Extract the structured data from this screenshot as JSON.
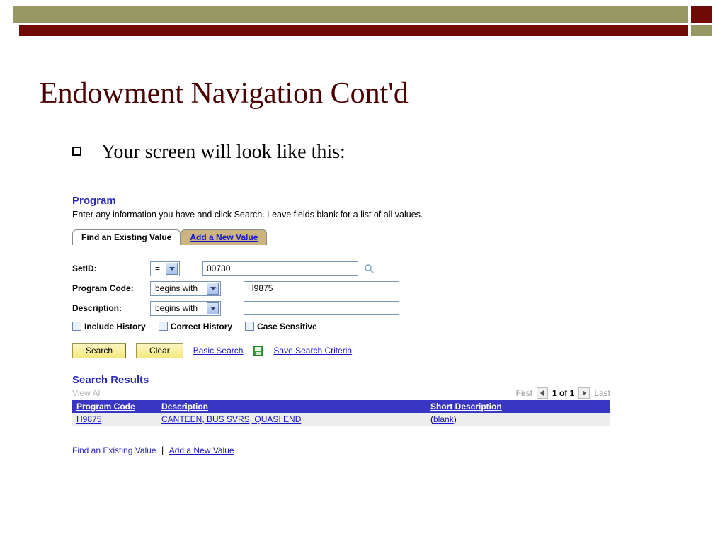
{
  "slide": {
    "title": "Endowment Navigation Cont'd",
    "bullet_text": "Your screen will look like this:"
  },
  "app": {
    "heading": "Program",
    "instruction": "Enter any information you have and click Search. Leave fields blank for a list of all values.",
    "tabs": {
      "active_label": "Find an Existing Value",
      "inactive_label": "Add a New Value"
    },
    "fields": {
      "setid": {
        "label": "SetID:",
        "op": "=",
        "value": "00730"
      },
      "program_code": {
        "label": "Program Code:",
        "op": "begins with",
        "value": "H9875"
      },
      "description": {
        "label": "Description:",
        "op": "begins with",
        "value": ""
      }
    },
    "checkboxes": {
      "include_history": "Include History",
      "correct_history": "Correct History",
      "case_sensitive": "Case Sensitive"
    },
    "buttons": {
      "search": "Search",
      "clear": "Clear",
      "basic_search": "Basic Search",
      "save_search": "Save Search Criteria"
    },
    "results": {
      "heading": "Search Results",
      "view_all": "View All",
      "pager": {
        "first": "First",
        "pos": "1 of 1",
        "last": "Last"
      },
      "columns": {
        "program_code": "Program Code",
        "description": "Description",
        "short_description": "Short Description"
      },
      "rows": [
        {
          "program_code": "H9875",
          "description": "CANTEEN, BUS SVRS, QUASI END",
          "short_description": "(blank)"
        }
      ]
    },
    "bottom_links": {
      "find": "Find an Existing Value",
      "add": "Add a New Value"
    }
  }
}
